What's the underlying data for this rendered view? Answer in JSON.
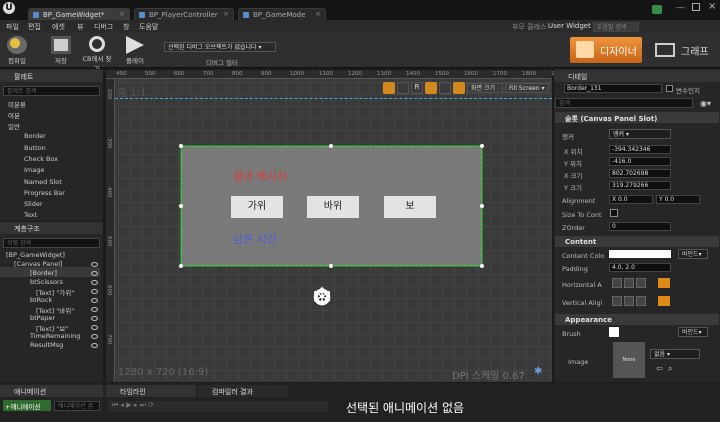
{
  "tabs": [
    {
      "label": "BP_GameWidget*"
    },
    {
      "label": "BP_PlayerController"
    },
    {
      "label": "BP_GameMode"
    }
  ],
  "titlebar": {
    "parent_class_label": "부모 클래스:",
    "parent_class_value": "User Widget",
    "help_search": "도움말 검색"
  },
  "menu": [
    "파일",
    "편집",
    "에셋",
    "뷰",
    "디버그",
    "창",
    "도움말"
  ],
  "toolbar": {
    "compile": "컴파일",
    "save": "저장",
    "browse": "CB에서 찾기",
    "play": "플레이",
    "debug_select": "선택된 디버그 오브젝트가 없습니다",
    "debug_filter": "디버그 필터"
  },
  "mode": {
    "designer": "디자이너",
    "graph": "그래프"
  },
  "palette": {
    "title": "팔레트",
    "search_placeholder": "팔레트 검색",
    "categories": [
      "미분류",
      "여분",
      "일반"
    ],
    "items": [
      "Border",
      "Button",
      "Check Box",
      "Image",
      "Named Slot",
      "Progress Bar",
      "Slider",
      "Text"
    ]
  },
  "hierarchy": {
    "title": "계층구조",
    "search_placeholder": "위젯 검색",
    "items": [
      "[BP_GameWidget]",
      "[Canvas Panel]",
      "[Border]",
      "btScissors",
      "[Text] \"가위\"",
      "btRock",
      "[Text] \"바위\"",
      "btPaper",
      "[Text] \"보\"",
      "TimeRemaining",
      "ResultMsg"
    ]
  },
  "animations": {
    "title": "애니메이션",
    "add": "+애니메이션",
    "search_placeholder": "애니메이션 검"
  },
  "timeline": {
    "title": "타임라인",
    "compiler_title": "컴파일러 결과",
    "no_anim": "선택된 애니메이션 없음"
  },
  "canvas": {
    "zoom": "줌 1:1",
    "resolution": "1280 x 720 (16:9)",
    "dpi": "DPI 스케일 0.67",
    "screen_size": "화면 크기",
    "fill_screen": "Fill Screen",
    "rulers": [
      "400",
      "500",
      "600",
      "700",
      "800",
      "900",
      "1000",
      "1100",
      "1200",
      "1300",
      "1400",
      "1500",
      "1600",
      "1700",
      "1800",
      "1900"
    ],
    "vrulers": [
      "200",
      "300",
      "400",
      "500",
      "600",
      "700"
    ]
  },
  "game": {
    "result": "결과 메시지",
    "buttons": [
      "가위",
      "바위",
      "보"
    ],
    "time": "남은 시간"
  },
  "details": {
    "title": "디테일",
    "name": "Border_131",
    "is_variable": "변수인지",
    "search_placeholder": "검색",
    "slot_section": "슬롯 (Canvas Panel Slot)",
    "anchor_label": "앵커",
    "anchor_value": "앵커",
    "pos_x_label": "X 위치",
    "pos_x": "-394.342346",
    "pos_y_label": "Y 위치",
    "pos_y": "-416.0",
    "size_x_label": "X 크기",
    "size_x": "802.702698",
    "size_y_label": "Y 크기",
    "size_y": "319.279266",
    "alignment_label": "Alignment",
    "align_x": "X 0.0",
    "align_y": "Y 0.0",
    "size_to_content": "Size To Cont",
    "zorder_label": "ZOrder",
    "zorder": "0",
    "content_section": "Content",
    "content_color": "Content Colo",
    "bind": "바인드",
    "padding_label": "Padding",
    "padding": "4.0, 2.0",
    "halign": "Horizontal A",
    "valign": "Vertical Aligi",
    "appearance_section": "Appearance",
    "brush": "Brush",
    "image": "Image",
    "none": "None",
    "none2": "없음"
  },
  "colors": {
    "accent": "#e07b1a",
    "selection": "#3aa83a",
    "result_red": "#d83a3a",
    "time_blue": "#4a5be0"
  }
}
